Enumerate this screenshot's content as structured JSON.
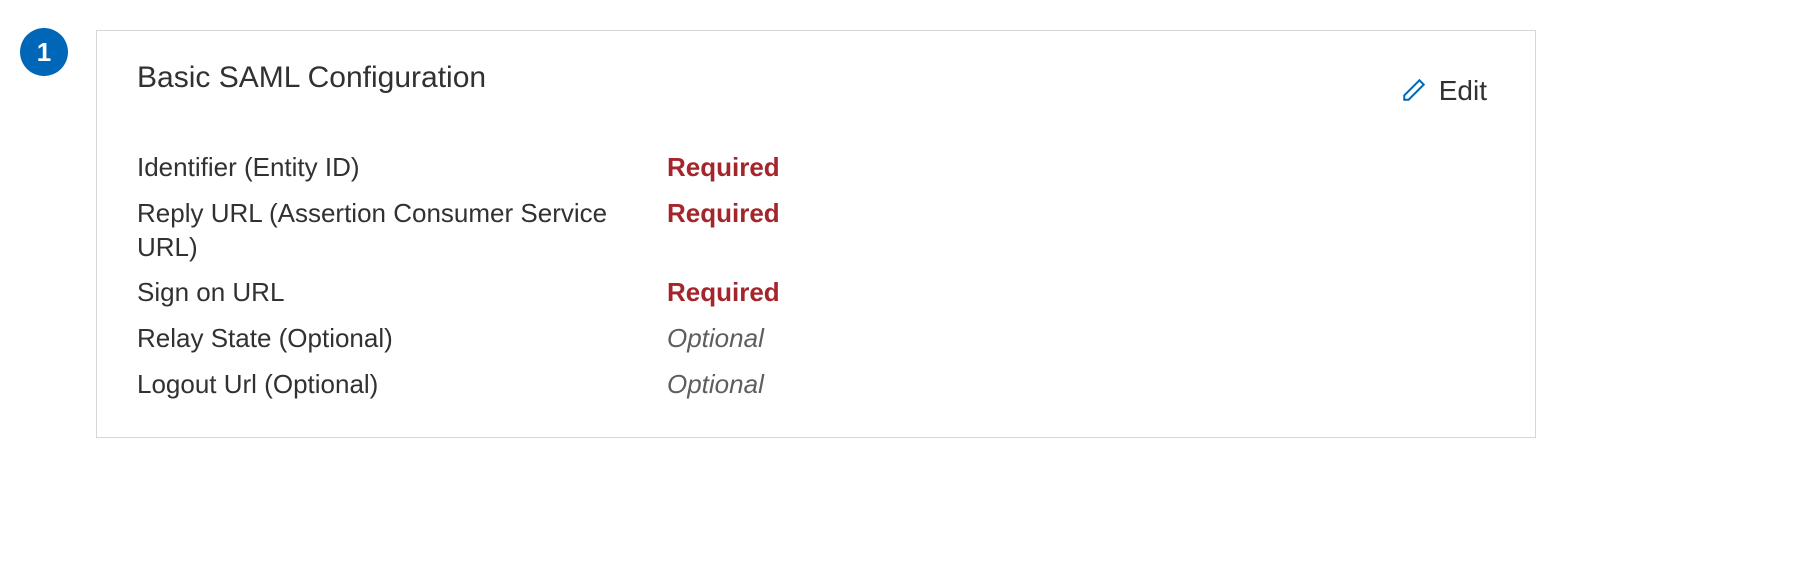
{
  "step": {
    "number": "1"
  },
  "card": {
    "title": "Basic SAML Configuration",
    "edit_label": "Edit"
  },
  "fields": [
    {
      "label": "Identifier (Entity ID)",
      "value": "Required",
      "kind": "required"
    },
    {
      "label": "Reply URL (Assertion Consumer Service URL)",
      "value": "Required",
      "kind": "required"
    },
    {
      "label": "Sign on URL",
      "value": "Required",
      "kind": "required"
    },
    {
      "label": "Relay State (Optional)",
      "value": "Optional",
      "kind": "optional"
    },
    {
      "label": "Logout Url (Optional)",
      "value": "Optional",
      "kind": "optional"
    }
  ]
}
